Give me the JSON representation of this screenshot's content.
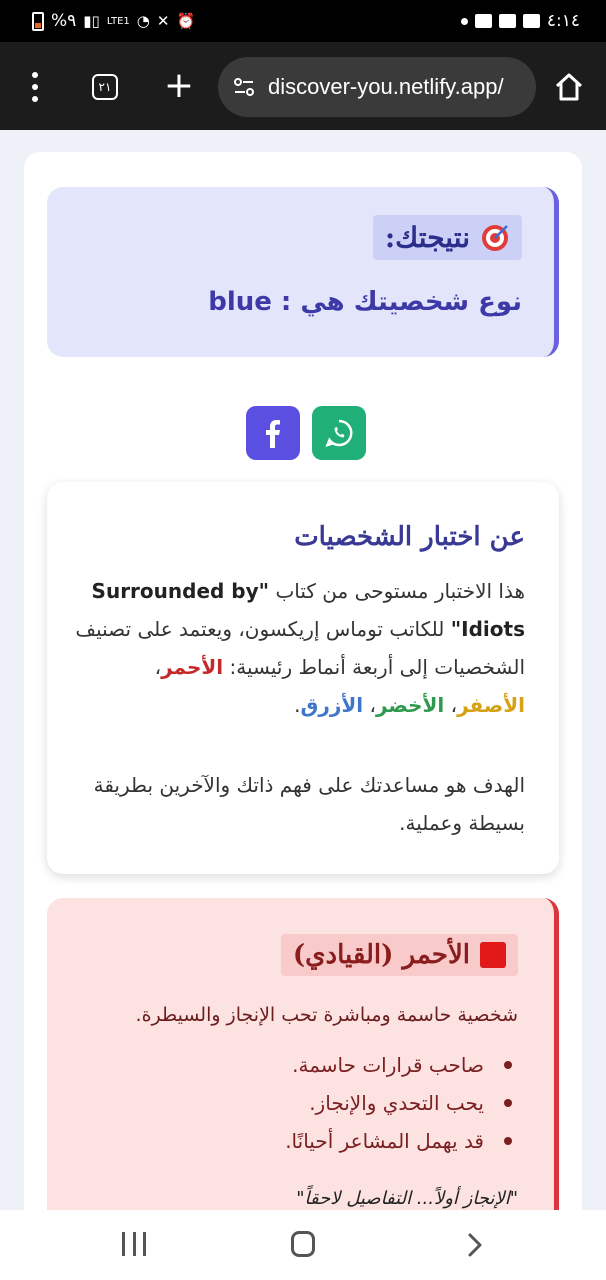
{
  "status_bar": {
    "battery_percent": "%٩",
    "network_label": "LTE1",
    "time": "٤:١٤"
  },
  "browser": {
    "tab_count": "٢١",
    "url": "discover-you.netlify.app/"
  },
  "result": {
    "title": "نتيجتك:",
    "type_line": "نوع شخصيتك هي : blue"
  },
  "share": {
    "facebook_icon": "facebook-icon",
    "whatsapp_icon": "whatsapp-icon"
  },
  "about": {
    "title": "عن اختبار الشخصيات",
    "text_before_book": "هذا الاختبار مستوحى من كتاب",
    "book_title": "\"Surrounded by Idiots\"",
    "text_after_book": "للكاتب توماس إريكسون، ويعتمد على تصنيف الشخصيات إلى أربعة أنماط رئيسية:",
    "color_red": "الأحمر",
    "color_yellow": "الأصفر",
    "color_green": "الأخضر",
    "color_blue": "الأزرق",
    "goal": "الهدف هو مساعدتك على فهم ذاتك والآخرين بطريقة بسيطة وعملية."
  },
  "red_type": {
    "title": "الأحمر (القيادي)",
    "description": "شخصية حاسمة ومباشرة تحب الإنجاز والسيطرة.",
    "traits": [
      "صاحب قرارات حاسمة.",
      "يحب التحدي والإنجاز.",
      "قد يهمل المشاعر أحيانًا."
    ],
    "quote": "\"الإنجاز أولاً... التفاصيل لاحقاً\""
  },
  "colors": {
    "accent": "#6b60e0",
    "red_accent": "#d9363e",
    "whatsapp": "#1faf77"
  }
}
